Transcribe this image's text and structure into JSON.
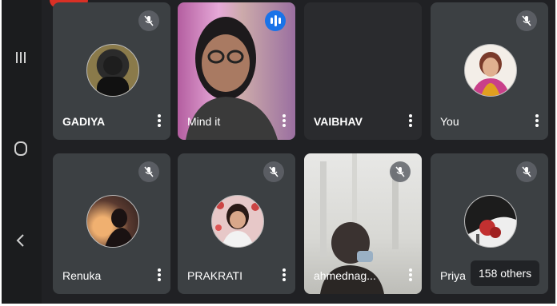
{
  "participants": [
    {
      "name": "GADIYA",
      "muted": true
    },
    {
      "name": "Mind it",
      "muted": false
    },
    {
      "name": "VAIBHAV",
      "muted": false
    },
    {
      "name": "You",
      "muted": true
    },
    {
      "name": "Renuka",
      "muted": true
    },
    {
      "name": "PRAKRATI",
      "muted": true
    },
    {
      "name": "ahmednag...",
      "muted": true
    },
    {
      "name": "Priya",
      "muted": true
    }
  ],
  "overflow": {
    "label": "158 others"
  },
  "colors": {
    "tile": "#3c4043",
    "background": "#202124",
    "accent": "#1a73e8"
  },
  "icons": [
    "recents-icon",
    "home-icon",
    "back-icon",
    "mic-off-icon",
    "more-vert-icon",
    "speaking-icon"
  ]
}
